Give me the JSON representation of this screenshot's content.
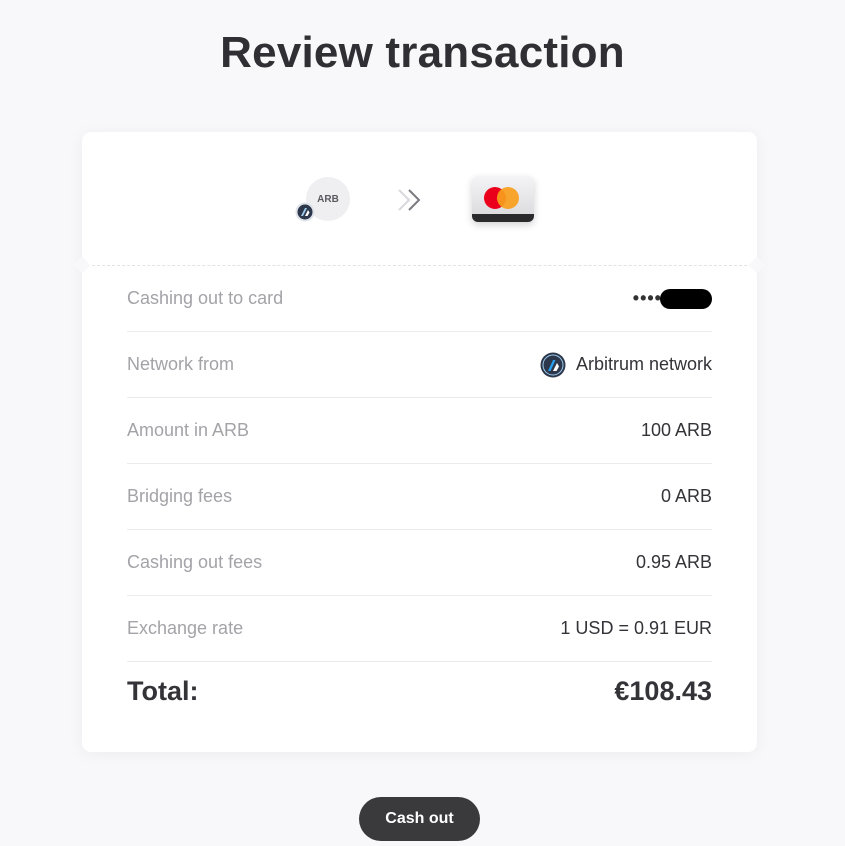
{
  "page": {
    "title": "Review transaction"
  },
  "header": {
    "token_label": "ARB",
    "arrows_icon": "double-chevron-right-icon",
    "card_icon": "mastercard-icon",
    "network_badge_icon": "arbitrum-icon"
  },
  "details": {
    "rows": [
      {
        "label": "Cashing out to card",
        "value": "••••"
      },
      {
        "label": "Network from",
        "value": "Arbitrum network"
      },
      {
        "label": "Amount in ARB",
        "value": "100 ARB"
      },
      {
        "label": "Bridging fees",
        "value": "0 ARB"
      },
      {
        "label": "Cashing out fees",
        "value": "0.95 ARB"
      },
      {
        "label": "Exchange rate",
        "value": "1 USD = 0.91 EUR"
      }
    ]
  },
  "total": {
    "label": "Total:",
    "value": "€108.43"
  },
  "actions": {
    "cash_out_label": "Cash out"
  },
  "colors": {
    "background": "#f8f8fa",
    "button": "#3a3a3c",
    "mastercard_red": "#eb001b",
    "mastercard_yellow": "#f79e1b"
  }
}
